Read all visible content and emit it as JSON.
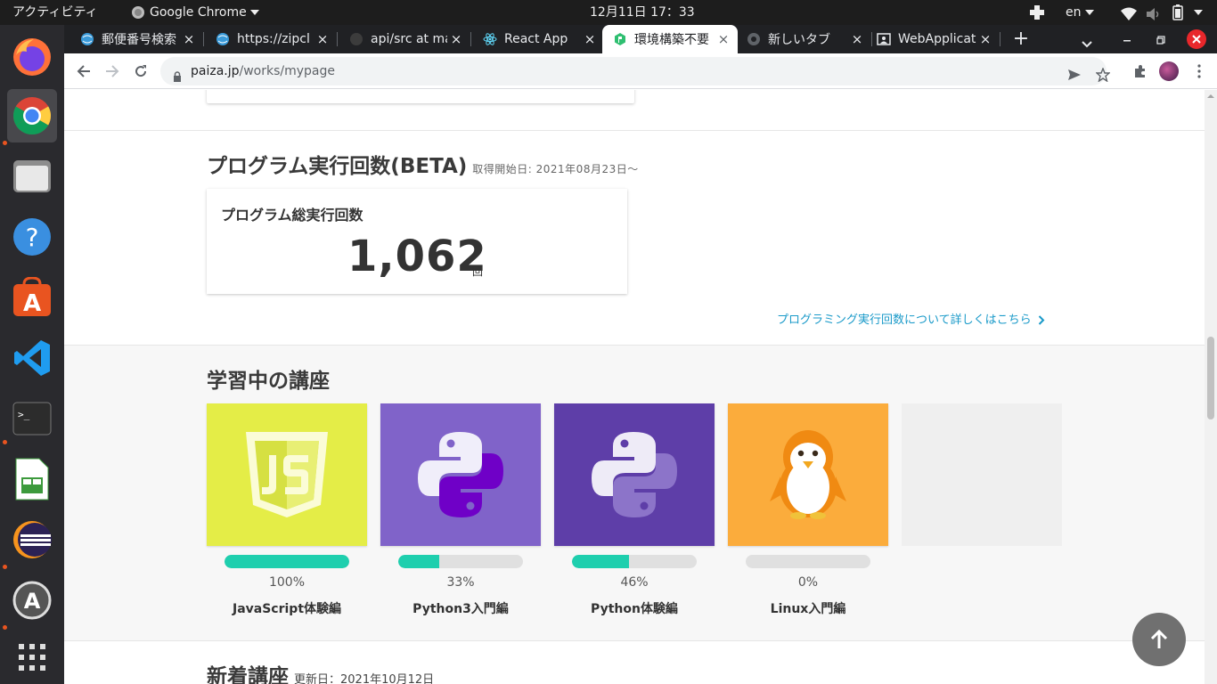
{
  "system": {
    "activities": "アクティビティ",
    "app_menu": "Google Chrome",
    "clock": "12月11日  17：33",
    "lang": "en"
  },
  "tabs": [
    {
      "title": "郵便番号検索",
      "favicon": "globe-icon"
    },
    {
      "title": "https://zipcl",
      "favicon": "globe-icon"
    },
    {
      "title": "api/src at ma",
      "favicon": "github-icon"
    },
    {
      "title": "React App",
      "favicon": "react-icon"
    },
    {
      "title": "環境構築不要",
      "favicon": "paiza-icon",
      "active": true
    },
    {
      "title": "新しいタブ",
      "favicon": "chrome-icon"
    },
    {
      "title": "WebApplicat",
      "favicon": "image-icon"
    }
  ],
  "toolbar": {
    "url_host": "paiza.jp",
    "url_path": "/works/mypage",
    "new_tab": "+",
    "close_symbol": "×"
  },
  "program_runs": {
    "title": "プログラム実行回数(BETA)",
    "subtitle": "取得開始日: 2021年08月23日〜",
    "card_title": "プログラム総実行回数",
    "count": "1,062",
    "unit": "回",
    "link": "プログラミング実行回数について詳しくはこちら"
  },
  "learning": {
    "title": "学習中の講座",
    "courses": [
      {
        "name": "JavaScript体験編",
        "progress": "100%",
        "fraction": 1.0,
        "color": "#e4ed47",
        "icon": "javascript-logo-icon"
      },
      {
        "name": "Python3入門編",
        "progress": "33%",
        "fraction": 0.33,
        "color": "#8063c9",
        "icon": "python-logo-icon"
      },
      {
        "name": "Python体験編",
        "progress": "46%",
        "fraction": 0.46,
        "color": "#5e3ea8",
        "icon": "python-logo-icon"
      },
      {
        "name": "Linux入門編",
        "progress": "0%",
        "fraction": 0.0,
        "color": "#fbac3c",
        "icon": "penguin-icon"
      }
    ]
  },
  "new_courses": {
    "title": "新着講座",
    "updated": "更新日：2021年10月12日"
  },
  "colors": {
    "accent_teal": "#1ecfae",
    "link_blue": "#1a9ac9",
    "section_bg": "#f7f7f7"
  }
}
